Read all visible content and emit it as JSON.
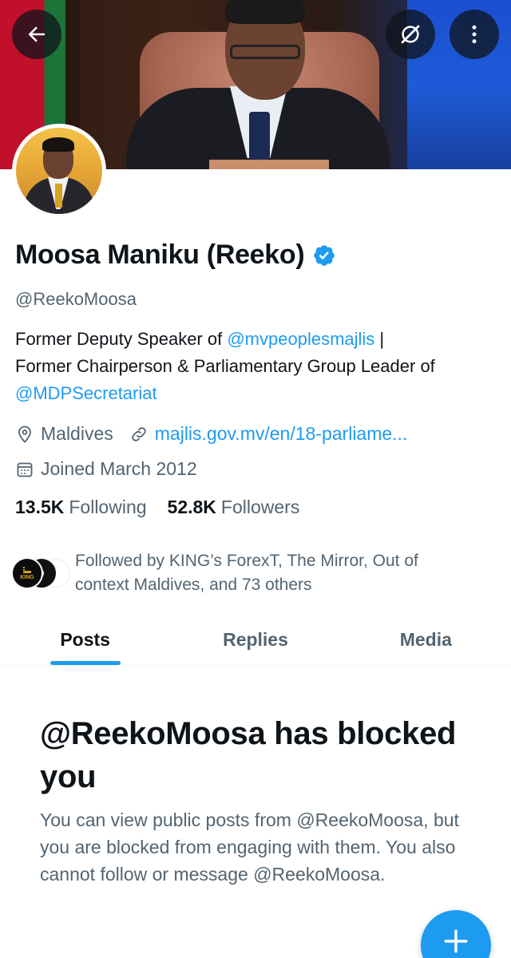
{
  "header": {
    "back_icon": "arrow-left-icon",
    "grok_icon": "grok-slash-icon",
    "more_icon": "more-vertical-icon"
  },
  "profile": {
    "name": "Moosa Maniku (Reeko)",
    "verified": true,
    "handle": "@ReekoMoosa",
    "bio": {
      "line1_prefix": "Former Deputy Speaker of ",
      "mention1": "@mvpeoplesmajlis",
      "line1_suffix": " |",
      "line2": "Former Chairperson & Parliamentary Group Leader of",
      "mention2": "@MDPSecretariat"
    },
    "location": "Maldives",
    "website": "majlis.gov.mv/en/18-parliame...",
    "joined": "Joined March 2012",
    "following_count": "13.5K",
    "following_label": "Following",
    "followers_count": "52.8K",
    "followers_label": "Followers",
    "followed_by": "Followed by KING’s ForexT, The Mirror, Out of context Maldives, and 73 others",
    "followed_avatar_badge": "KING"
  },
  "tabs": [
    {
      "label": "Posts",
      "active": true
    },
    {
      "label": "Replies",
      "active": false
    },
    {
      "label": "Media",
      "active": false
    }
  ],
  "blocked": {
    "title": "@ReekoMoosa has blocked you",
    "description": "You can view public posts from @ReekoMoosa, but you are blocked from engaging with them. You also cannot follow or message @ReekoMoosa."
  },
  "colors": {
    "accent": "#1d9bf0",
    "text_primary": "#0f1419",
    "text_secondary": "#536471"
  }
}
